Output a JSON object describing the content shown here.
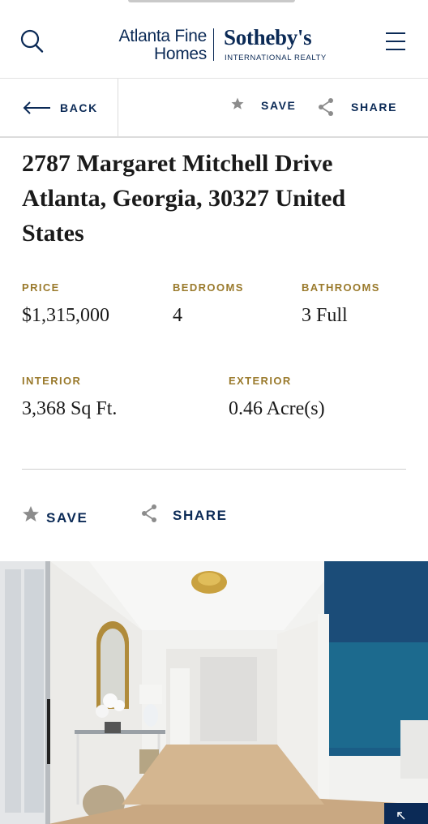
{
  "header": {
    "logo_line1": "Atlanta Fine",
    "logo_line2": "Homes",
    "brand": "Sotheby's",
    "brand_sub": "INTERNATIONAL REALTY",
    "search_icon": "search-icon",
    "menu_icon": "hamburger-menu-icon"
  },
  "actionbar": {
    "back_label": "BACK",
    "save_label": "SAVE",
    "share_label": "SHARE"
  },
  "listing": {
    "address_line1": "2787 Margaret Mitchell Drive",
    "address_line2": "Atlanta, Georgia, 30327 United",
    "address_line3": "States",
    "facts": {
      "price_label": "PRICE",
      "price_value": "$1,315,000",
      "bedrooms_label": "BEDROOMS",
      "bedrooms_value": "4",
      "bathrooms_label": "BATHROOMS",
      "bathrooms_value": "3 Full",
      "interior_label": "INTERIOR",
      "interior_value": "3,368 Sq Ft.",
      "exterior_label": "EXTERIOR",
      "exterior_value": "0.46 Acre(s)"
    }
  },
  "actions": {
    "save_label": "SAVE",
    "share_label": "SHARE"
  },
  "colors": {
    "brand_navy": "#0b2a56",
    "label_gold": "#9a7a2c",
    "text": "#1a1a1a"
  }
}
